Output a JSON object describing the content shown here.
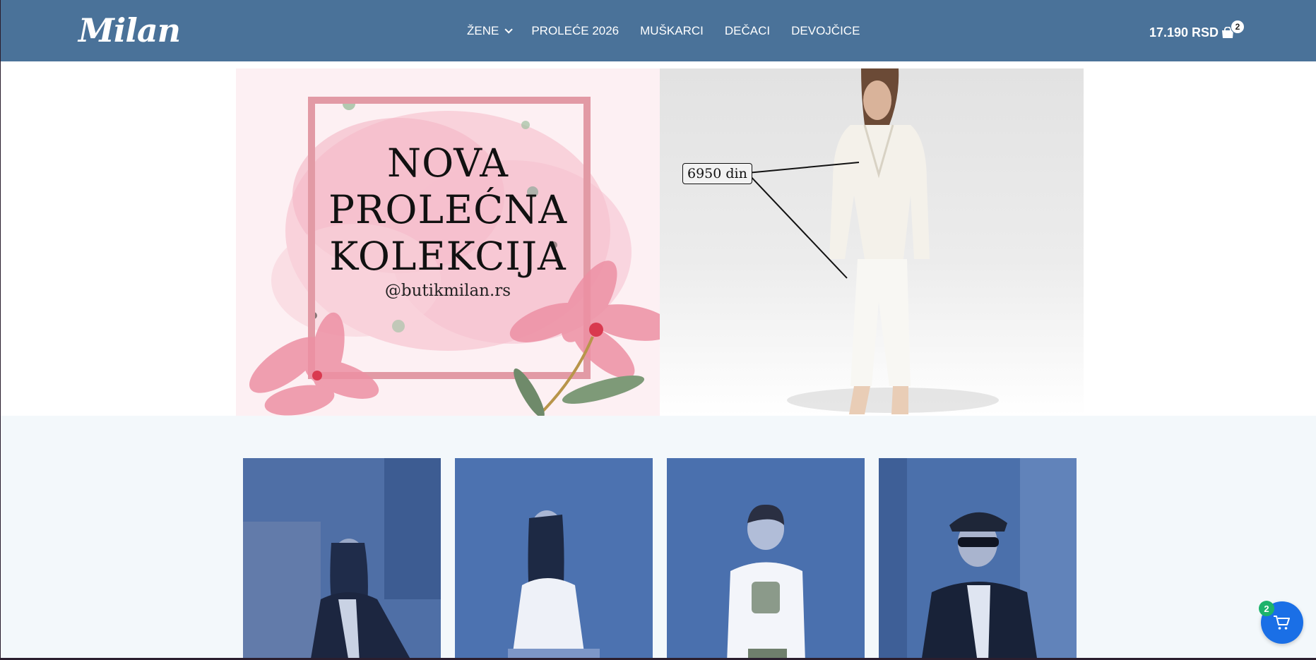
{
  "brand": {
    "logo": "Milan"
  },
  "nav": {
    "items": [
      {
        "label": "ŽENE",
        "has_dropdown": true
      },
      {
        "label": "PROLEĆE 2026"
      },
      {
        "label": "MUŠKARCI"
      },
      {
        "label": "DEČACI"
      },
      {
        "label": "DEVOJČICE"
      }
    ]
  },
  "cart": {
    "total": "17.190 RSD",
    "count": "2",
    "icon": "shopping-bag-icon"
  },
  "hero": {
    "left": {
      "title_lines": [
        "NOVA",
        "PROLEĆNA",
        "KOLEKCIJA"
      ],
      "handle": "@butikmilan.rs"
    },
    "right": {
      "price_tag": "6950 din"
    }
  },
  "categories": {
    "cards": [
      {
        "name": "category-card-women"
      },
      {
        "name": "category-card-girls"
      },
      {
        "name": "category-card-boys"
      },
      {
        "name": "category-card-men"
      }
    ]
  },
  "floating_cart": {
    "count": "2",
    "icon": "cart-icon"
  },
  "colors": {
    "header_bg": "#4a7299",
    "section_bg": "#f3f8fb",
    "overlay_blue": "#3e64ad",
    "frame_pink": "#e29aa5",
    "fab_blue": "#1a6fe6",
    "badge_green": "#1db36b"
  }
}
